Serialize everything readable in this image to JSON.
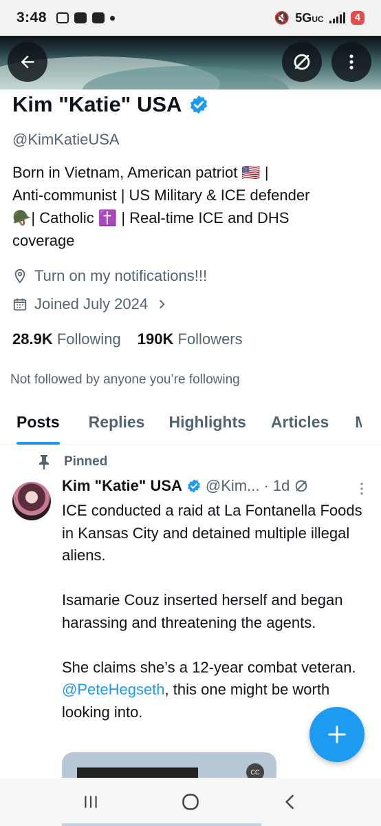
{
  "status_bar": {
    "time": "3:48",
    "network": "5G",
    "network_suffix": "UC",
    "notifications_count": "4"
  },
  "profile": {
    "name": "Kim \"Katie\" USA",
    "handle": "@KimKatieUSA",
    "bio_line1": "Born in Vietnam, American patriot 🇺🇸 |",
    "bio_line2": "Anti-communist | US Military & ICE defender",
    "bio_line3": "🪖| Catholic ✝️ | Real-time ICE and DHS",
    "bio_line4": "coverage",
    "location": "Turn on my notifications!!!",
    "joined": "Joined July 2024",
    "following_count": "28.9K",
    "following_label": "Following",
    "followers_count": "190K",
    "followers_label": "Followers",
    "not_followed": "Not followed by anyone you’re following"
  },
  "tabs": [
    {
      "label": "Posts",
      "active": true
    },
    {
      "label": "Replies",
      "active": false
    },
    {
      "label": "Highlights",
      "active": false
    },
    {
      "label": "Articles",
      "active": false
    },
    {
      "label": "Media",
      "active": false
    }
  ],
  "pinned_post": {
    "pinned_label": "Pinned",
    "author_name": "Kim \"Katie\" USA",
    "author_handle": "@Kim...",
    "time": "· 1d",
    "para1": "ICE conducted a raid at La Fontanella Foods in Kansas City and detained multiple illegal aliens.",
    "para2": "Isamarie Couz inserted herself and began harassing and threatening the agents.",
    "para3_before": "She claims she’s a 12-year combat veteran. ",
    "para3_mention": "@PeteHegseth",
    "para3_after": ", this one might be worth looking into.",
    "media_caption": "",
    "cc_label": "CC"
  },
  "colors": {
    "accent": "#1d9bf0",
    "text": "#0f1419",
    "secondary_text": "#536471"
  },
  "icons": {
    "back": "back-arrow-icon",
    "grok": "grok-icon",
    "more": "more-vertical-icon",
    "location": "location-pin-icon",
    "calendar": "calendar-icon",
    "pin": "pin-icon",
    "compose": "plus-icon"
  }
}
